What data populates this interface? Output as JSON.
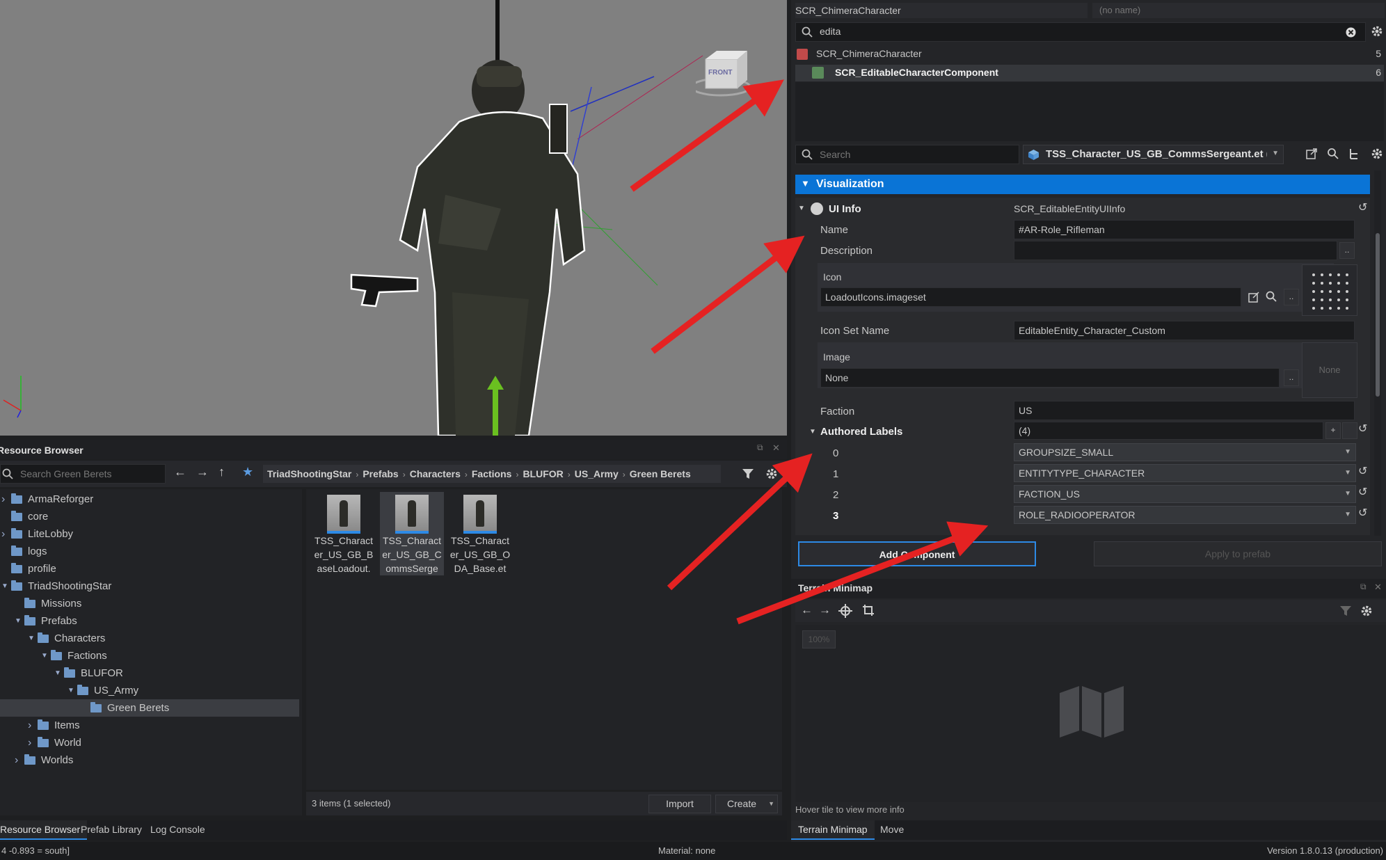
{
  "colors": {
    "accent": "#0a74d6",
    "panel": "#242528",
    "viewport": "#808080",
    "arrow": "#e52222"
  },
  "entity_panel": {
    "header_left": "SCR_ChimeraCharacter",
    "header_right_placeholder": "(no name)",
    "search_value": "edita",
    "rows": [
      {
        "label": "SCR_ChimeraCharacter",
        "count": "5"
      },
      {
        "label": "SCR_EditableCharacterComponent",
        "count": "6"
      }
    ]
  },
  "properties": {
    "search_placeholder": "Search",
    "prefab_name": "TSS_Character_US_GB_CommsSergeant.et (",
    "section": "Visualization",
    "ui_info": {
      "label": "UI Info",
      "value": "SCR_EditableEntityUIInfo"
    },
    "name": {
      "label": "Name",
      "value": "#AR-Role_Rifleman"
    },
    "description": {
      "label": "Description",
      "value": ""
    },
    "icon": {
      "label": "Icon",
      "value": "LoadoutIcons.imageset"
    },
    "icon_set_name": {
      "label": "Icon Set Name",
      "value": "EditableEntity_Character_Custom"
    },
    "image": {
      "label": "Image",
      "value": "None",
      "preview": "None"
    },
    "faction": {
      "label": "Faction",
      "value": "US"
    },
    "authored_labels": {
      "label": "Authored Labels",
      "count": "(4)",
      "items": [
        {
          "index": "0",
          "value": "GROUPSIZE_SMALL"
        },
        {
          "index": "1",
          "value": "ENTITYTYPE_CHARACTER"
        },
        {
          "index": "2",
          "value": "FACTION_US"
        },
        {
          "index": "3",
          "value": "ROLE_RADIOOPERATOR"
        }
      ]
    },
    "add_component": "Add Component",
    "apply_to_prefab": "Apply to prefab"
  },
  "minimap": {
    "title": "Terrain Minimap",
    "zoom": "100%",
    "hint": "Hover tile to view more info",
    "tabs": [
      "Terrain Minimap",
      "Move"
    ]
  },
  "resource_browser": {
    "title": "Resource Browser",
    "search_placeholder": "Search Green Berets",
    "breadcrumbs": [
      "TriadShootingStar",
      "Prefabs",
      "Characters",
      "Factions",
      "BLUFOR",
      "US_Army",
      "Green Berets"
    ],
    "tree": [
      {
        "label": "ArmaReforger",
        "level": 0,
        "arrow": "right",
        "locked": true
      },
      {
        "label": "core",
        "level": 0,
        "arrow": "none",
        "locked": true
      },
      {
        "label": "LiteLobby",
        "level": 0,
        "arrow": "right",
        "locked": false
      },
      {
        "label": "logs",
        "level": 0,
        "arrow": "none",
        "locked": false
      },
      {
        "label": "profile",
        "level": 0,
        "arrow": "none",
        "locked": false
      },
      {
        "label": "TriadShootingStar",
        "level": 0,
        "arrow": "down",
        "locked": false
      },
      {
        "label": "Missions",
        "level": 1,
        "arrow": "none",
        "locked": false
      },
      {
        "label": "Prefabs",
        "level": 1,
        "arrow": "down",
        "locked": false
      },
      {
        "label": "Characters",
        "level": 2,
        "arrow": "down",
        "locked": false
      },
      {
        "label": "Factions",
        "level": 3,
        "arrow": "down",
        "locked": false
      },
      {
        "label": "BLUFOR",
        "level": 4,
        "arrow": "down",
        "locked": false
      },
      {
        "label": "US_Army",
        "level": 5,
        "arrow": "down",
        "locked": false
      },
      {
        "label": "Green Berets",
        "level": 6,
        "arrow": "none",
        "locked": false,
        "selected": true
      },
      {
        "label": "Items",
        "level": 2,
        "arrow": "right",
        "locked": false
      },
      {
        "label": "World",
        "level": 2,
        "arrow": "right",
        "locked": false
      },
      {
        "label": "Worlds",
        "level": 1,
        "arrow": "right",
        "locked": false
      }
    ],
    "files": [
      {
        "lines": [
          "TSS_Charact",
          "er_US_GB_B",
          "aseLoadout."
        ],
        "selected": false
      },
      {
        "lines": [
          "TSS_Charact",
          "er_US_GB_C",
          "ommsSerge"
        ],
        "selected": true
      },
      {
        "lines": [
          "TSS_Charact",
          "er_US_GB_O",
          "DA_Base.et"
        ],
        "selected": false
      }
    ],
    "status": "3 items (1 selected)",
    "import": "Import",
    "create": "Create",
    "tabs": [
      "Resource Browser",
      "Prefab Library",
      "Log Console"
    ]
  },
  "statusbar": {
    "left": "4 -0.893 = south]",
    "middle": "Material: none",
    "right": "Version 1.8.0.13 (production)"
  },
  "gizmo_label": "FRONT"
}
